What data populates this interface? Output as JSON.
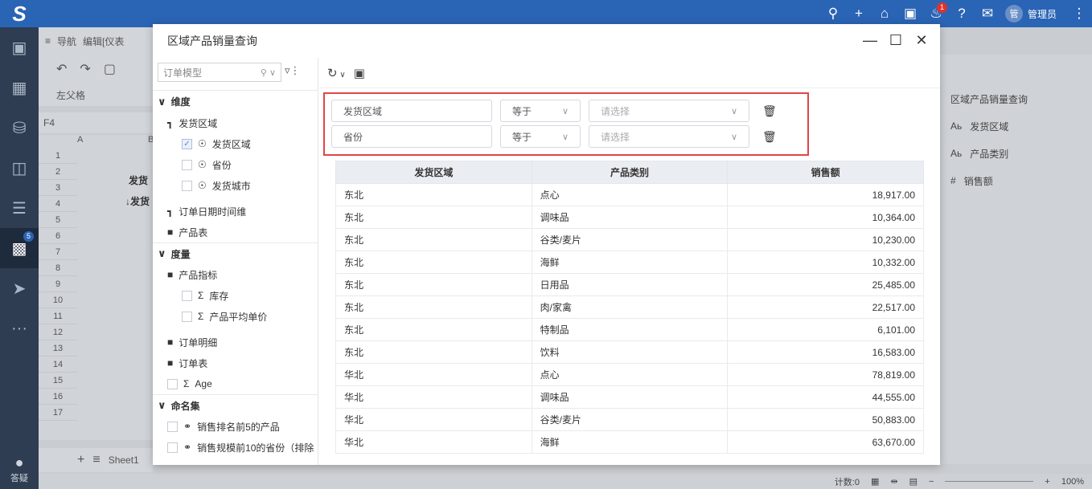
{
  "app": {
    "logo": "S"
  },
  "topbar": {
    "icons": [
      "search-icon",
      "plus-icon",
      "home-icon",
      "briefcase-icon",
      "bell-icon",
      "help-icon",
      "chat-icon"
    ],
    "notification_count": "1",
    "avatar_text": "管",
    "user_name": "管理员",
    "more": "⋮"
  },
  "leftnav": {
    "badge": "5",
    "help_label": "答疑"
  },
  "background": {
    "tabs": [
      "导航",
      "编辑[仪表"
    ],
    "toolbar_label": "左父格",
    "cell_ref": "F4",
    "col_a": "A",
    "col_b": "B",
    "cell_b2": "发货",
    "cell_b3": "↓发货",
    "rows": [
      "1",
      "2",
      "3",
      "4",
      "5",
      "6",
      "7",
      "8",
      "9",
      "10",
      "11",
      "12",
      "13",
      "14",
      "15",
      "16",
      "17"
    ],
    "sheet_tab": "Sheet1",
    "right_panel": {
      "title": "区域产品销量查询",
      "items": [
        {
          "icon": "Aь",
          "label": "发货区域"
        },
        {
          "icon": "Aь",
          "label": "产品类别"
        },
        {
          "icon": "#",
          "label": "销售额"
        }
      ]
    },
    "status": {
      "count": "计数:0",
      "zoom": "100%"
    }
  },
  "dialog": {
    "title": "区域产品销量查询",
    "left_panel": {
      "model": "订单模型",
      "dimension_title": "维度",
      "dimension_items": [
        {
          "type": "hier",
          "label": "发货区域"
        },
        {
          "type": "field",
          "label": "发货区域",
          "checked": true
        },
        {
          "type": "field",
          "label": "省份",
          "checked": false
        },
        {
          "type": "field",
          "label": "发货城市",
          "checked": false
        },
        {
          "type": "hier",
          "label": "订单日期时间维"
        },
        {
          "type": "folder",
          "label": "产品表"
        }
      ],
      "measure_title": "度量",
      "measure_items": [
        {
          "type": "folder",
          "label": "产品指标"
        },
        {
          "type": "measure",
          "label": "库存"
        },
        {
          "type": "measure",
          "label": "产品平均单价"
        },
        {
          "type": "folder",
          "label": "订单明细"
        },
        {
          "type": "folder",
          "label": "订单表"
        },
        {
          "type": "measure",
          "label": "Age"
        }
      ],
      "named_title": "命名集",
      "named_items": [
        {
          "label": "销售排名前5的产品"
        },
        {
          "label": "销售规模前10的省份（排除"
        }
      ]
    },
    "filters": [
      {
        "field": "发货区域",
        "op": "等于",
        "placeholder": "请选择"
      },
      {
        "field": "省份",
        "op": "等于",
        "placeholder": "请选择"
      }
    ],
    "table": {
      "headers": [
        "发货区域",
        "产品类别",
        "销售额"
      ],
      "rows": [
        [
          "东北",
          "点心",
          "18,917.00"
        ],
        [
          "东北",
          "调味品",
          "10,364.00"
        ],
        [
          "东北",
          "谷类/麦片",
          "10,230.00"
        ],
        [
          "东北",
          "海鲜",
          "10,332.00"
        ],
        [
          "东北",
          "日用品",
          "25,485.00"
        ],
        [
          "东北",
          "肉/家禽",
          "22,517.00"
        ],
        [
          "东北",
          "特制品",
          "6,101.00"
        ],
        [
          "东北",
          "饮料",
          "16,583.00"
        ],
        [
          "华北",
          "点心",
          "78,819.00"
        ],
        [
          "华北",
          "调味品",
          "44,555.00"
        ],
        [
          "华北",
          "谷类/麦片",
          "50,883.00"
        ],
        [
          "华北",
          "海鲜",
          "63,670.00"
        ]
      ]
    }
  }
}
